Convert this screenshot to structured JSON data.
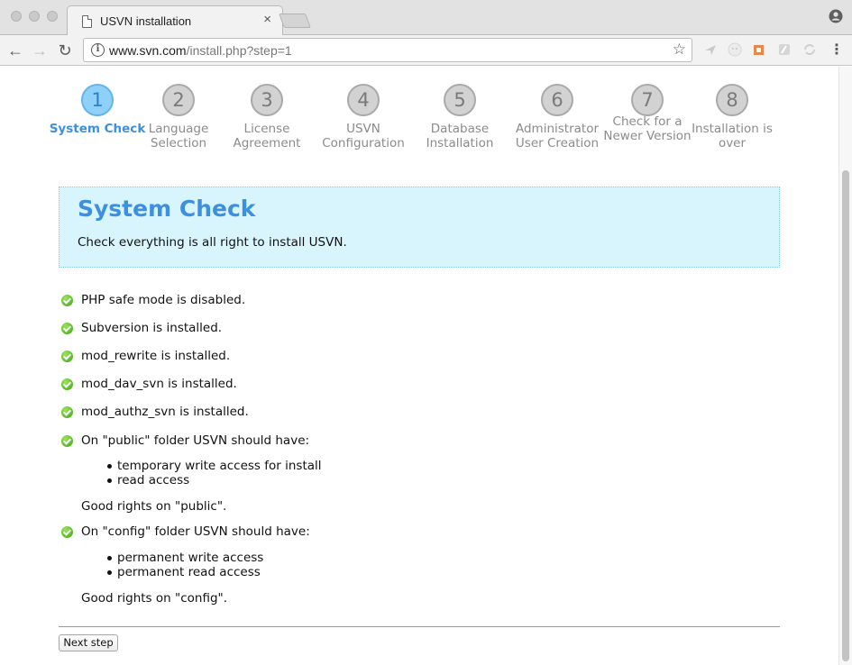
{
  "browser": {
    "tab_title": "USVN installation",
    "tab_close": "×",
    "url_host": "www.svn.com",
    "url_path": "/install.php?step=1"
  },
  "steps": [
    {
      "number": "1",
      "label": "System Check",
      "active": true
    },
    {
      "number": "2",
      "label": "Language Selection",
      "active": false
    },
    {
      "number": "3",
      "label": "License Agreement",
      "active": false
    },
    {
      "number": "4",
      "label": "USVN Configuration",
      "active": false
    },
    {
      "number": "5",
      "label": "Database Installation",
      "active": false
    },
    {
      "number": "6",
      "label": "Administrator User Creation",
      "active": false
    },
    {
      "number": "7",
      "label": "Check for a Newer Version",
      "active": false
    },
    {
      "number": "8",
      "label": "Installation is over",
      "active": false
    }
  ],
  "hero": {
    "title": "System Check",
    "subtitle": "Check everything is all right to install USVN."
  },
  "checks": [
    "PHP safe mode is disabled.",
    "Subversion is installed.",
    "mod_rewrite is installed.",
    "mod_dav_svn is installed.",
    "mod_authz_svn is installed.",
    "On \"public\" folder USVN should have:",
    "On \"config\" folder USVN should have:"
  ],
  "public_rights": [
    "temporary write access for install",
    "read access"
  ],
  "public_note": "Good rights on \"public\".",
  "config_rights": [
    "permanent write access",
    "permanent read access"
  ],
  "config_note": "Good rights on \"config\".",
  "next_button": "Next step"
}
